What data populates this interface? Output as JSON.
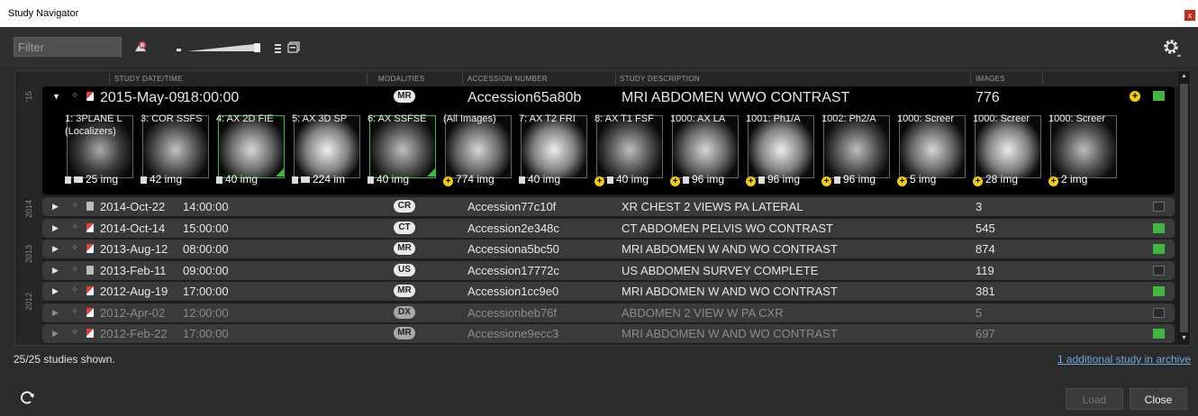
{
  "window": {
    "title": "Study Navigator",
    "close_glyph": "x"
  },
  "toolbar": {
    "filter_placeholder": "Filter",
    "icons": [
      "clear-filter-icon",
      "thumbnail-size-slider",
      "list-view-icon",
      "panel-view-icon",
      "settings-gear-icon"
    ]
  },
  "columns": {
    "date": "STUDY DATE/TIME",
    "modalities": "MODALITIES",
    "accession": "ACCESSION NUMBER",
    "description": "STUDY DESCRIPTION",
    "images": "IMAGES"
  },
  "years": [
    "'15",
    "2014",
    "2013",
    "2012"
  ],
  "expanded": {
    "date": "2015-May-09",
    "time": "18:00:00",
    "modality": "MR",
    "accession": "Accession65a80b",
    "description": "MRI ABDOMEN WWO CONTRAST",
    "images": "776",
    "status_color": "#3fb63f",
    "series": [
      {
        "label": "1: 3PLANE L",
        "label2": "(Localizers)",
        "count": "25 img",
        "icon": "folder",
        "selected": false
      },
      {
        "label": "3: COR SSFS",
        "label2": "",
        "count": "42 img",
        "icon": "cube",
        "selected": false
      },
      {
        "label": "4: AX 2D FIE",
        "label2": "",
        "count": "40 img",
        "icon": "cube",
        "selected": true
      },
      {
        "label": "5: AX 3D SP",
        "label2": "",
        "count": "224 im",
        "icon": "folder",
        "selected": false
      },
      {
        "label": "6: AX SSFSE",
        "label2": "",
        "count": "40 img",
        "icon": "cube",
        "selected": true
      },
      {
        "label": "(All Images)",
        "label2": "",
        "count": "774 img",
        "icon": "plus",
        "selected": false
      },
      {
        "label": "7: AX T2 FRI",
        "label2": "",
        "count": "40 img",
        "icon": "cube",
        "selected": false
      },
      {
        "label": "8: AX T1 FSF",
        "label2": "",
        "count": "40 img",
        "icon": "plus-cube",
        "selected": false
      },
      {
        "label": "1000: AX LA",
        "label2": "",
        "count": "96 img",
        "icon": "plus-cube",
        "selected": false
      },
      {
        "label": "1001: Ph1/A",
        "label2": "",
        "count": "96 img",
        "icon": "plus-cube",
        "selected": false
      },
      {
        "label": "1002: Ph2/A",
        "label2": "",
        "count": "96 img",
        "icon": "plus-cube",
        "selected": false
      },
      {
        "label": "1000: Screer",
        "label2": "",
        "count": "5 img",
        "icon": "plus",
        "selected": false
      },
      {
        "label": "1000: Screer",
        "label2": "",
        "count": "28 img",
        "icon": "plus",
        "selected": false
      },
      {
        "label": "1000: Screer",
        "label2": "",
        "count": "2 img",
        "icon": "plus",
        "selected": false
      }
    ]
  },
  "studies": [
    {
      "date": "2014-Oct-22",
      "time": "14:00:00",
      "modality": "CR",
      "accession": "Accession77c10f",
      "description": "XR CHEST 2 VIEWS PA LATERAL",
      "images": "3",
      "status": "empty",
      "dim": false,
      "doc": "gray"
    },
    {
      "date": "2014-Oct-14",
      "time": "15:00:00",
      "modality": "CT",
      "accession": "Accession2e348c",
      "description": "CT ABDOMEN PELVIS WO CONTRAST",
      "images": "545",
      "status": "green",
      "dim": false,
      "doc": "red"
    },
    {
      "date": "2013-Aug-12",
      "time": "08:00:00",
      "modality": "MR",
      "accession": "Accessiona5bc50",
      "description": "MRI ABDOMEN W AND WO CONTRAST",
      "images": "874",
      "status": "green",
      "dim": false,
      "doc": "red"
    },
    {
      "date": "2013-Feb-11",
      "time": "09:00:00",
      "modality": "US",
      "accession": "Accession17772c",
      "description": "US ABDOMEN SURVEY COMPLETE",
      "images": "119",
      "status": "empty",
      "dim": false,
      "doc": "gray"
    },
    {
      "date": "2012-Aug-19",
      "time": "17:00:00",
      "modality": "MR",
      "accession": "Accession1cc9e0",
      "description": "MRI ABDOMEN W AND WO CONTRAST",
      "images": "381",
      "status": "green",
      "dim": false,
      "doc": "red"
    },
    {
      "date": "2012-Apr-02",
      "time": "12:00:00",
      "modality": "DX",
      "accession": "Accessionbeb76f",
      "description": "ABDOMEN 2 VIEW W PA CXR",
      "images": "5",
      "status": "empty",
      "dim": true,
      "doc": "red"
    },
    {
      "date": "2012-Feb-22",
      "time": "17:00:00",
      "modality": "MR",
      "accession": "Accessione9ecc3",
      "description": "MRI ABDOMEN W AND WO CONTRAST",
      "images": "697",
      "status": "green",
      "dim": true,
      "doc": "red"
    }
  ],
  "footer": {
    "shown": "25/25 studies shown.",
    "archive_link": "1 additional study in archive",
    "load_label": "Load",
    "close_label": "Close"
  }
}
